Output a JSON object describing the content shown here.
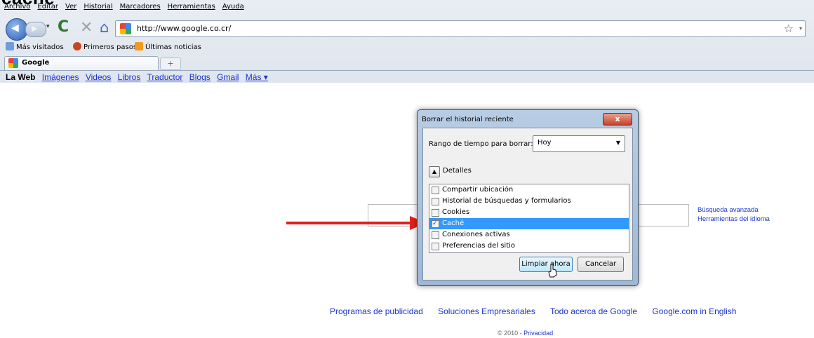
{
  "top_heading": "caché",
  "menu": [
    "Archivo",
    "Editar",
    "Ver",
    "Historial",
    "Marcadores",
    "Herramientas",
    "Ayuda"
  ],
  "url": "http://www.google.co.cr/",
  "bookmarks": [
    "Más visitados",
    "Primeros pasos",
    "Últimas noticias"
  ],
  "tab": {
    "label": "Google",
    "new_tab": "+"
  },
  "gbar": {
    "current": "La Web",
    "links": [
      "Imágenes",
      "Videos",
      "Libros",
      "Traductor",
      "Blogs",
      "Gmail",
      "Más ▾"
    ]
  },
  "side_links": [
    "Búsqueda avanzada",
    "Herramientas del idioma"
  ],
  "footer": [
    "Programas de publicidad",
    "Soluciones Empresariales",
    "Todo acerca de Google",
    "Google.com in English"
  ],
  "copyright": {
    "text": "© 2010 - ",
    "link": "Privacidad"
  },
  "dialog": {
    "title": "Borrar el historial reciente",
    "close": "x",
    "range_label": "Rango de tiempo para borrar:",
    "range_value": "Hoy",
    "details": "Detalles",
    "items": [
      {
        "label": "Compartir ubicación",
        "checked": false
      },
      {
        "label": "Historial de búsquedas y formularios",
        "checked": false
      },
      {
        "label": "Cookies",
        "checked": false
      },
      {
        "label": "Caché",
        "checked": true
      },
      {
        "label": "Conexiones activas",
        "checked": false
      },
      {
        "label": "Preferencias del sitio",
        "checked": false
      }
    ],
    "clear_button": "Limpiar ahora",
    "cancel_button": "Cancelar"
  },
  "colors": {
    "arrow": "#e3201b",
    "link": "#1a33cc",
    "selection": "#3399ff"
  }
}
